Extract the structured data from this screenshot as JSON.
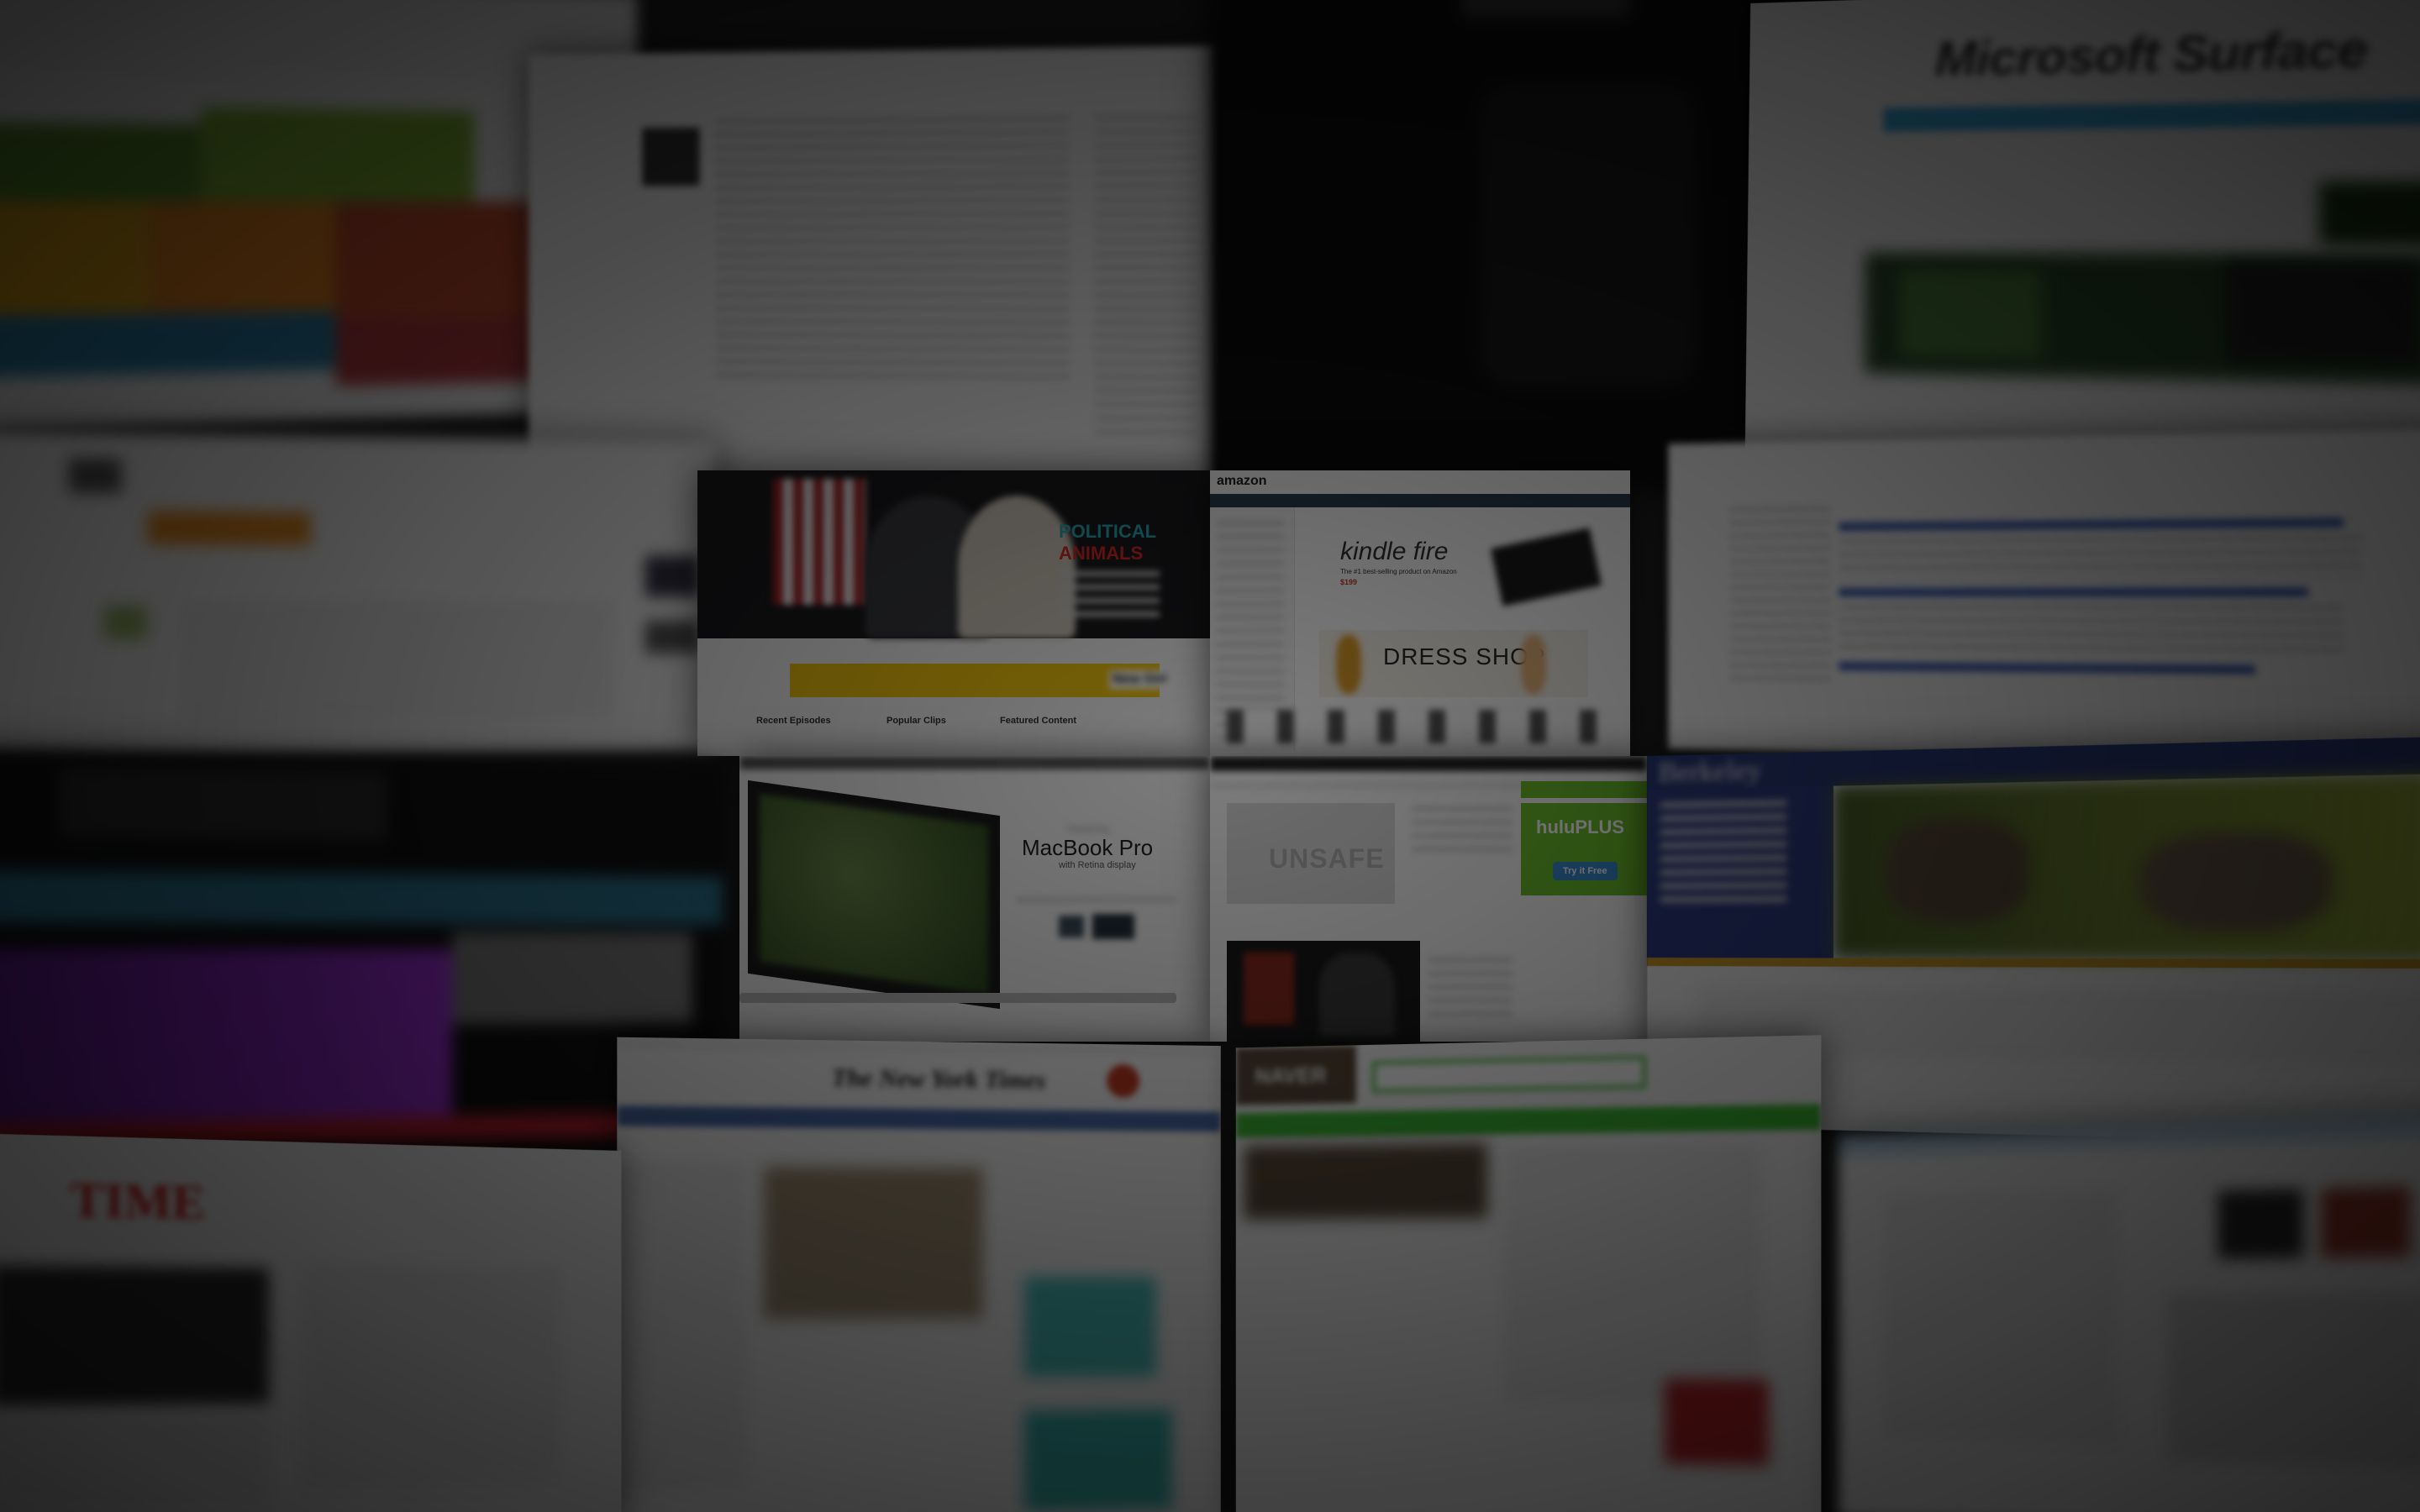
{
  "collage": {
    "brands": {
      "microsoft": "Microsoft Surface",
      "amazon": "amazon",
      "kindle": "kindle fire",
      "kindle_tagline": "The #1 best-selling product on Amazon",
      "kindle_price": "$199",
      "dress_shop": "DRESS SHOP",
      "political": "POLITICAL",
      "animals": "ANIMALS",
      "newgirl": "New Girl",
      "macbook": "MacBook Pro",
      "macbook_sub": "with Retina display",
      "unsafe": "UNSAFE",
      "hulu": "huluPLUS",
      "hulu_btn": "Try it Free",
      "nyt": "The New York Times",
      "naver": "NAVER",
      "time": "TIME",
      "berkeley": "Berkeley",
      "recent_episodes": "Recent Episodes",
      "popular_clips": "Popular Clips",
      "featured_content": "Featured Content"
    },
    "colors": {
      "amazon_orange": "#f49a1a",
      "naver_green": "#3dbb34",
      "hulu_green": "#6cbf2c",
      "time_red": "#d81e1e",
      "berkeley_navy": "#2a3a78",
      "political_red": "#d72a26"
    }
  }
}
